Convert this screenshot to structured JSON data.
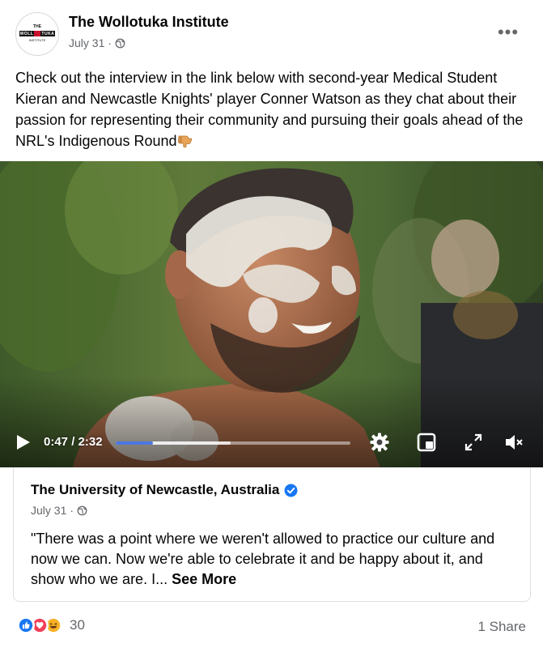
{
  "post": {
    "page_name": "The Wollotuka Institute",
    "date": "July 31",
    "separator": "·",
    "logo": {
      "top": "THE",
      "band_left": "WOLL",
      "band_right": "TUKA",
      "bottom": "INSTITUTE"
    },
    "more_label": "•••",
    "text": "Check out the interview in the link below with second-year Medical Student Kieran and Newcastle Knights' player Conner Watson as they chat about their passion for representing their community and pursuing their goals ahead of the NRL's Indigenous Round"
  },
  "video": {
    "time_display": "0:47 / 2:32",
    "progress": 0.16,
    "buffered": 0.49
  },
  "link_card": {
    "name": "The University of Newcastle, Australia",
    "date": "July 31",
    "separator": "·",
    "text": "\"There was a point where we weren't allowed to practice our culture and now we can. Now we're able to celebrate it and be happy about it, and show who we are. I...",
    "see_more": "See More"
  },
  "footer": {
    "reaction_count": "30",
    "share_label": "1 Share"
  },
  "colors": {
    "like_blue": "#1877f2",
    "love_red": "#f33e58",
    "haha_yellow": "#f7b125",
    "secondary_text": "#65676b",
    "progress_blue": "#4a78e0"
  }
}
